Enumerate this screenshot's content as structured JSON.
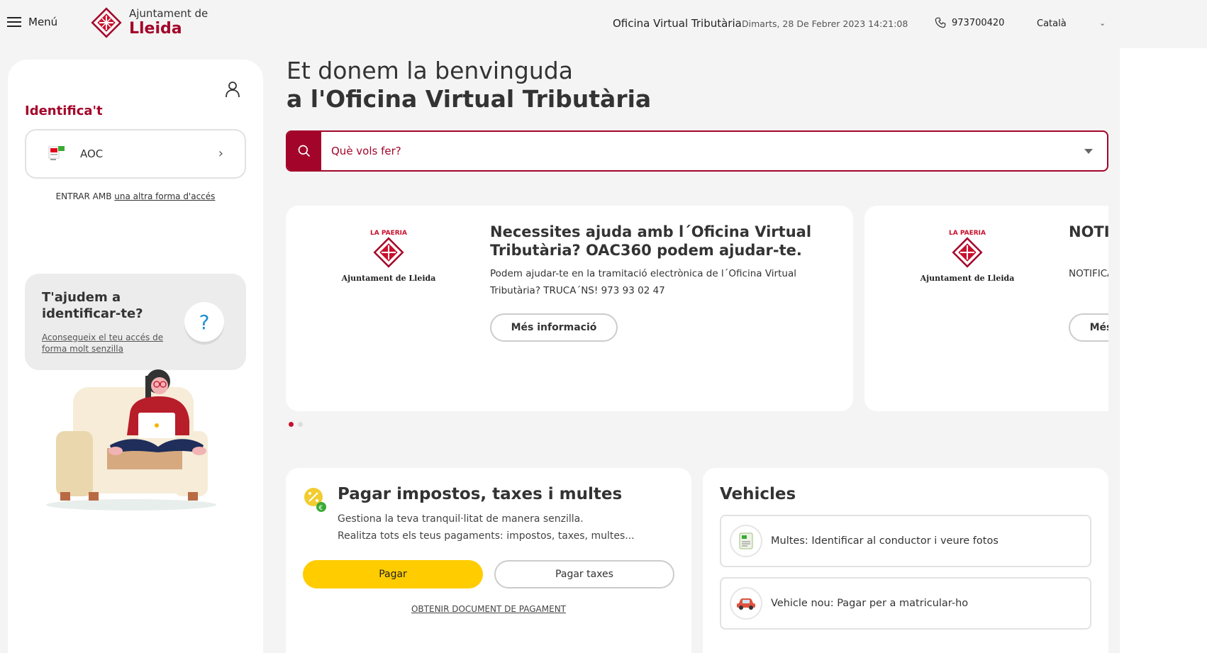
{
  "header": {
    "menu_label": "Menú",
    "logo_small": "Ajuntament de",
    "logo_big": "Lleida",
    "office_title": "Oficina Virtual Tributària",
    "datetime": "Dimarts, 28 De Febrer 2023 14:21:08",
    "phone": "973700420",
    "language": "Català"
  },
  "login": {
    "title": "Identifica't",
    "aoc_label": "AOC",
    "enter_prefix": "ENTRAR AMB",
    "enter_link": "una altra forma d'accés"
  },
  "help": {
    "title": "T'ajudem a identificar-te?",
    "link": "Aconsegueix el teu accés de forma molt senzilla",
    "question_mark": "?"
  },
  "welcome": {
    "line1": "Et donem la benvinguda",
    "line2": "a l'Oficina Virtual Tributària"
  },
  "search": {
    "placeholder": "Què vols fer?"
  },
  "news": [
    {
      "logo_top": "LA PAERIA",
      "logo_caption": "Ajuntament de Lleida",
      "title": "Necessites ajuda amb l´Oficina Virtual Tributària? OAC360 podem ajudar-te.",
      "text": "Podem ajudar-te en la tramitació electrònica de l´Oficina Virtual Tributària? TRUCA´NS! 973 93 02 47",
      "button": "Més informació"
    },
    {
      "logo_top": "LA PAERIA",
      "logo_caption": "Ajuntament de Lleida",
      "title": "NOTIFICACIONS empreses i contactes",
      "text": "NOTIFICACIONS adreça electrònica puguis rebre electrònicament",
      "button": "Més informació"
    }
  ],
  "payments": {
    "title": "Pagar impostos, taxes i multes",
    "desc1": "Gestiona la teva tranquil·litat de manera senzilla.",
    "desc2": "Realitza tots els teus pagaments: impostos, taxes, multes...",
    "btn_pay": "Pagar",
    "btn_taxes": "Pagar taxes",
    "document_link": "OBTENIR DOCUMENT DE PAGAMENT"
  },
  "vehicles": {
    "title": "Vehicles",
    "items": [
      {
        "label": "Multes: Identificar al conductor i veure fotos",
        "icon": "fine-document-icon"
      },
      {
        "label": "Vehicle nou: Pagar per a matricular-ho",
        "icon": "car-icon"
      }
    ]
  },
  "colors": {
    "brand": "#a3052a",
    "accent_yellow": "#ffcc00"
  }
}
